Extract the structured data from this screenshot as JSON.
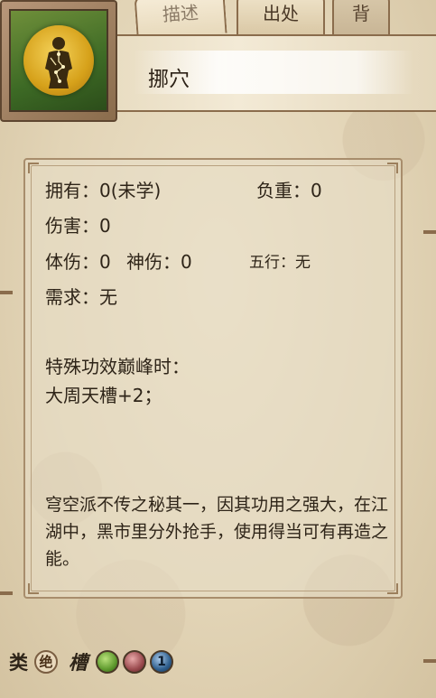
{
  "tabs": [
    {
      "label": "描述",
      "state": "active"
    },
    {
      "label": "出处",
      "state": "normal"
    },
    {
      "label": "背",
      "state": "dim"
    }
  ],
  "skill": {
    "name": "挪穴",
    "icon": "meridian-body-icon"
  },
  "stats": {
    "owned": "拥有：0(未学)",
    "weight": "负重：0",
    "damage": "伤害：0",
    "body_damage": "体伤：0",
    "spirit_damage": "神伤：0",
    "element": "五行：无",
    "requirement": "需求：无"
  },
  "special": {
    "heading": "特殊功效巅峰时：",
    "value": "大周天槽+2；"
  },
  "description": "穹空派不传之秘其一，因其功用之强大，在江湖中，黑市里分外抢手，使用得当可有再造之能。",
  "footer": {
    "category_label": "类",
    "category_badge": "绝",
    "slot_label": "槽",
    "slots": [
      {
        "color": "#5f9a2e",
        "icon": "green-orb-icon"
      },
      {
        "color": "#9a4a4e",
        "icon": "red-orb-icon"
      },
      {
        "color": "#2f5f8e",
        "label": "1",
        "icon": "blue-orb-icon"
      }
    ]
  }
}
